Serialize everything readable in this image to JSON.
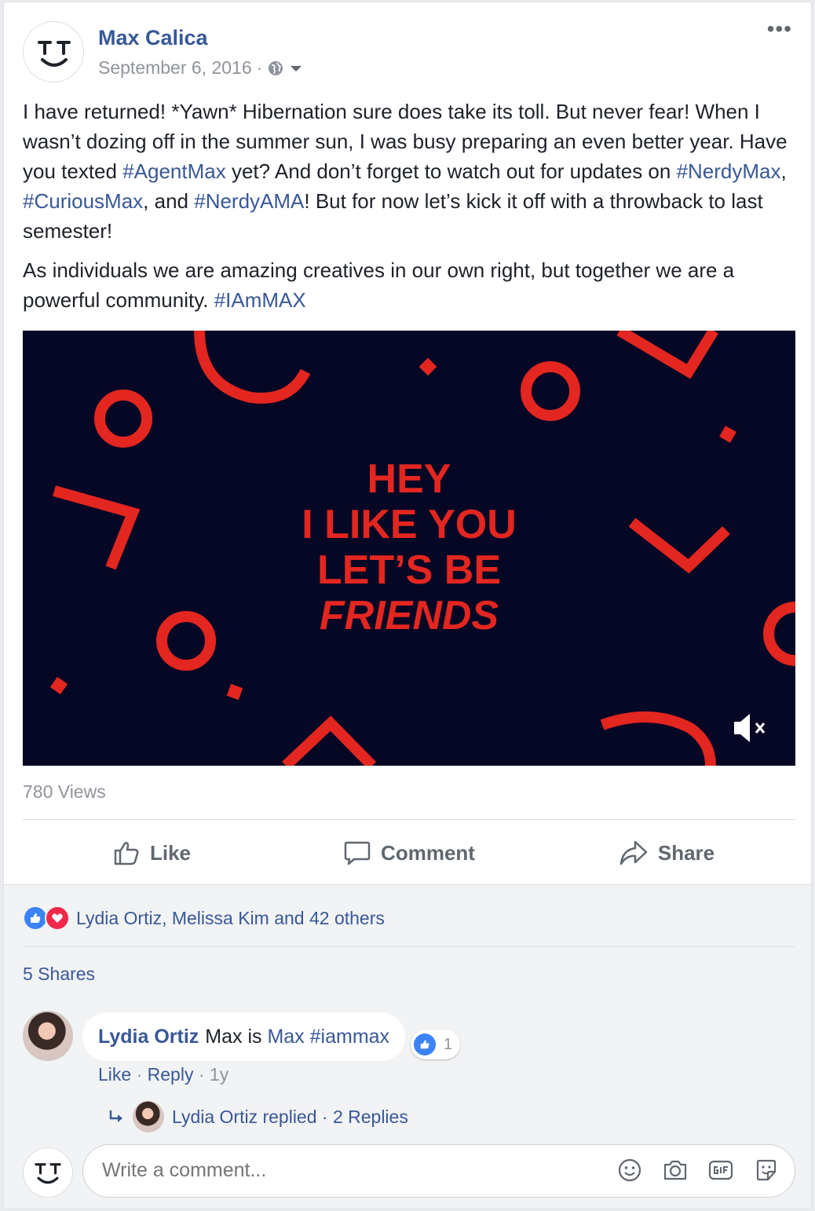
{
  "post": {
    "author": "Max Calica",
    "date": "September 6, 2016",
    "separator": "·",
    "more": "•••",
    "paragraph1": {
      "t1": "I have returned! *Yawn* Hibernation sure does take its toll. But never fear! When I wasn’t dozing off in the summer sun, I was busy preparing an even better year. Have you texted ",
      "tag1": "#AgentMax",
      "t2": " yet? And don’t forget to watch out for updates on ",
      "tag2": "#NerdyMax",
      "t3": ", ",
      "tag3": "#CuriousMax",
      "t4": ", and ",
      "tag4": "#NerdyAMA",
      "t5": "! But for now let’s kick it off with a throwback to last semester!"
    },
    "paragraph2": {
      "t1": "As individuals we are amazing creatives in our own right, but together we are a powerful community. ",
      "tag1": "#IAmMAX"
    }
  },
  "video": {
    "line1": "HEY",
    "line2": "I LIKE YOU",
    "line3": "LET’S BE",
    "line4": "FRIENDS",
    "colors": {
      "background": "#050725",
      "accent": "#e3261f"
    }
  },
  "stats": {
    "views": "780 Views",
    "shares": "5 Shares"
  },
  "actions": {
    "like": "Like",
    "comment": "Comment",
    "share": "Share"
  },
  "reactions": {
    "text": "Lydia Ortiz, Melissa Kim and 42 others"
  },
  "comment": {
    "author": "Lydia Ortiz",
    "t1": "Max is ",
    "mention": "Max",
    "tag": "#iammax",
    "like_count": "1",
    "like": "Like",
    "reply": "Reply",
    "time": "1y",
    "replies_text": "Lydia Ortiz replied · 2 Replies"
  },
  "composer": {
    "placeholder": "Write a comment..."
  },
  "colors": {
    "link": "#385898",
    "muted": "#90949c",
    "like_blue": "#3b83f6",
    "love_red": "#f0284a"
  }
}
